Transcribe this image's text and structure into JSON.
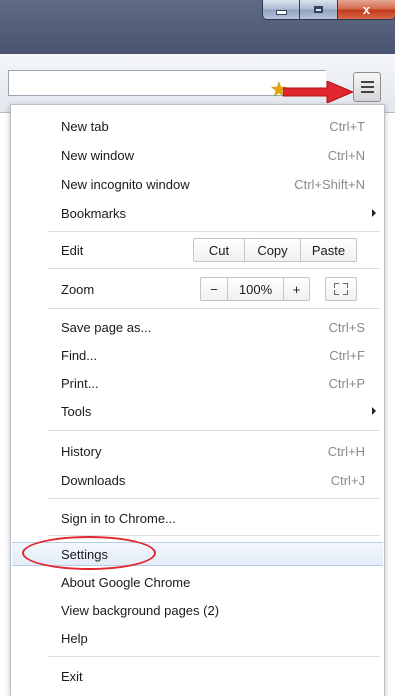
{
  "window": {
    "close_glyph": "x"
  },
  "menu": {
    "items": [
      {
        "label": "New tab",
        "shortcut": "Ctrl+T"
      },
      {
        "label": "New window",
        "shortcut": "Ctrl+N"
      },
      {
        "label": "New incognito window",
        "shortcut": "Ctrl+Shift+N"
      },
      {
        "label": "Bookmarks",
        "shortcut": ""
      }
    ],
    "edit": {
      "label": "Edit",
      "cut": "Cut",
      "copy": "Copy",
      "paste": "Paste"
    },
    "zoom": {
      "label": "Zoom",
      "minus": "−",
      "value": "100%",
      "plus": "+"
    },
    "page_items": [
      {
        "label": "Save page as...",
        "shortcut": "Ctrl+S"
      },
      {
        "label": "Find...",
        "shortcut": "Ctrl+F"
      },
      {
        "label": "Print...",
        "shortcut": "Ctrl+P"
      },
      {
        "label": "Tools",
        "shortcut": ""
      }
    ],
    "history_items": [
      {
        "label": "History",
        "shortcut": "Ctrl+H"
      },
      {
        "label": "Downloads",
        "shortcut": "Ctrl+J"
      }
    ],
    "sign_in": "Sign in to Chrome...",
    "settings_items": [
      {
        "label": "Settings"
      },
      {
        "label": "About Google Chrome"
      },
      {
        "label": "View background pages (2)"
      },
      {
        "label": "Help"
      }
    ],
    "exit": "Exit"
  },
  "colors": {
    "annotation": "#e0262e",
    "highlight_border": "#b8cce6"
  }
}
